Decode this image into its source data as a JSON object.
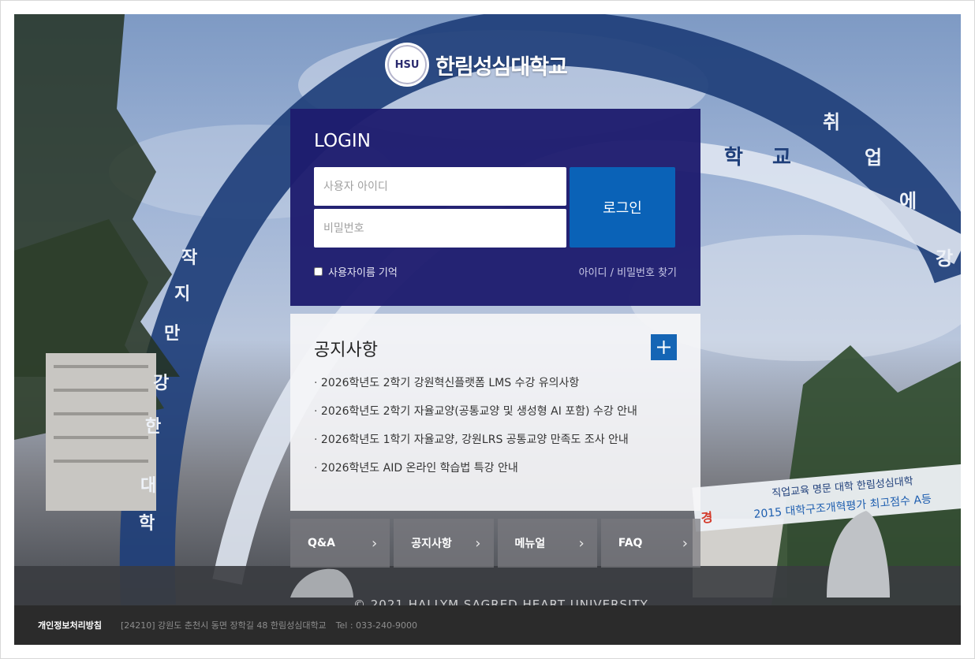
{
  "logo": {
    "seal_text": "HSU",
    "name": "한림성심대학교"
  },
  "login": {
    "title": "LOGIN",
    "id_placeholder": "사용자 아이디",
    "pw_placeholder": "비밀번호",
    "button_label": "로그인",
    "remember_label": "사용자이름 기억",
    "find_link": "아이디 / 비밀번호 찾기"
  },
  "notice": {
    "title": "공지사항",
    "more_label": "+",
    "items": [
      "2026학년도 2학기 강원혁신플랫폼 LMS 수강 유의사항",
      "2026학년도 2학기 자율교양(공통교양 및 생성형 AI 포함) 수강 안내",
      "2026학년도 1학기 자율교양, 강원LRS 공통교양 만족도 조사 안내",
      "2026학년도 AID 온라인 학습법 특강 안내"
    ]
  },
  "quick_links": [
    {
      "label": "Q&A"
    },
    {
      "label": "공지사항"
    },
    {
      "label": "메뉴얼"
    },
    {
      "label": "FAQ"
    }
  ],
  "copyright": "© 2021 HALLYM SAGRED HEART UNIVERSITY",
  "background_text": {
    "arch_left": [
      "작",
      "지",
      "만",
      "강",
      "한",
      "대",
      "학"
    ],
    "arch_right": [
      "취",
      "업",
      "에",
      "강"
    ],
    "arch_inner": "학 교",
    "banner_line1": "직업교육 명문 대학 한림성심대학",
    "banner_line2": "2015 대학구조개혁평가 최고점수 A등",
    "banner_prefix": "경"
  },
  "footer": {
    "privacy_link": "개인정보처리방침",
    "address": "[24210] 강원도 춘천시 동면 장학길 48 한림성심대학교",
    "tel": "Tel : 033-240-9000"
  },
  "colors": {
    "login_bg": "#1e1c6e",
    "login_button": "#0a62b7",
    "more_button": "#1565b5",
    "footer_bg": "#2b2b2b"
  }
}
